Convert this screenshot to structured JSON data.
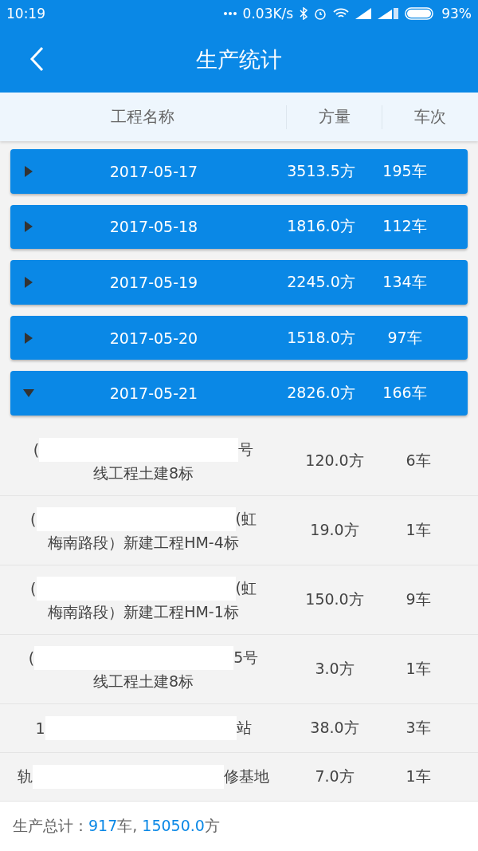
{
  "status_bar": {
    "time": "10:19",
    "speed": "0.03K/s",
    "battery": "93%"
  },
  "app_bar": {
    "title": "生产统计"
  },
  "columns": [
    "工程名称",
    "方量",
    "车次"
  ],
  "groups": [
    {
      "date": "2017-05-17",
      "volume": "3513.5方",
      "trips": "195车",
      "expanded": false
    },
    {
      "date": "2017-05-18",
      "volume": "1816.0方",
      "trips": "112车",
      "expanded": false
    },
    {
      "date": "2017-05-19",
      "volume": "2245.0方",
      "trips": "134车",
      "expanded": false
    },
    {
      "date": "2017-05-20",
      "volume": "1518.0方",
      "trips": "97车",
      "expanded": false
    },
    {
      "date": "2017-05-21",
      "volume": "2826.0方",
      "trips": "166车",
      "expanded": true,
      "rows": [
        {
          "name_start": "(",
          "name_end": "号",
          "name_line_2": "线工程土建8标",
          "volume": "120.0方",
          "trips": "6车"
        },
        {
          "name_start": "(",
          "name_end": "(虹",
          "name_line_2": "梅南路段）新建工程HM-4标",
          "volume": "19.0方",
          "trips": "1车"
        },
        {
          "name_start": "(",
          "name_end": "(虹",
          "name_line_2": "梅南路段）新建工程HM-1标",
          "volume": "150.0方",
          "trips": "9车"
        },
        {
          "name_start": "(",
          "name_end": "5号",
          "name_line_2": "线工程土建8标",
          "volume": "3.0方",
          "trips": "1车"
        },
        {
          "name_start": "1",
          "name_end": "站",
          "volume": "38.0方",
          "trips": "3车"
        },
        {
          "name_start": "轨",
          "name_end": "修基地",
          "volume": "7.0方",
          "trips": "1车"
        }
      ]
    }
  ],
  "footer": {
    "label": "生产总计：",
    "trips": "917",
    "trips_unit": "车, ",
    "volume": "15050.0",
    "volume_unit": "方"
  }
}
